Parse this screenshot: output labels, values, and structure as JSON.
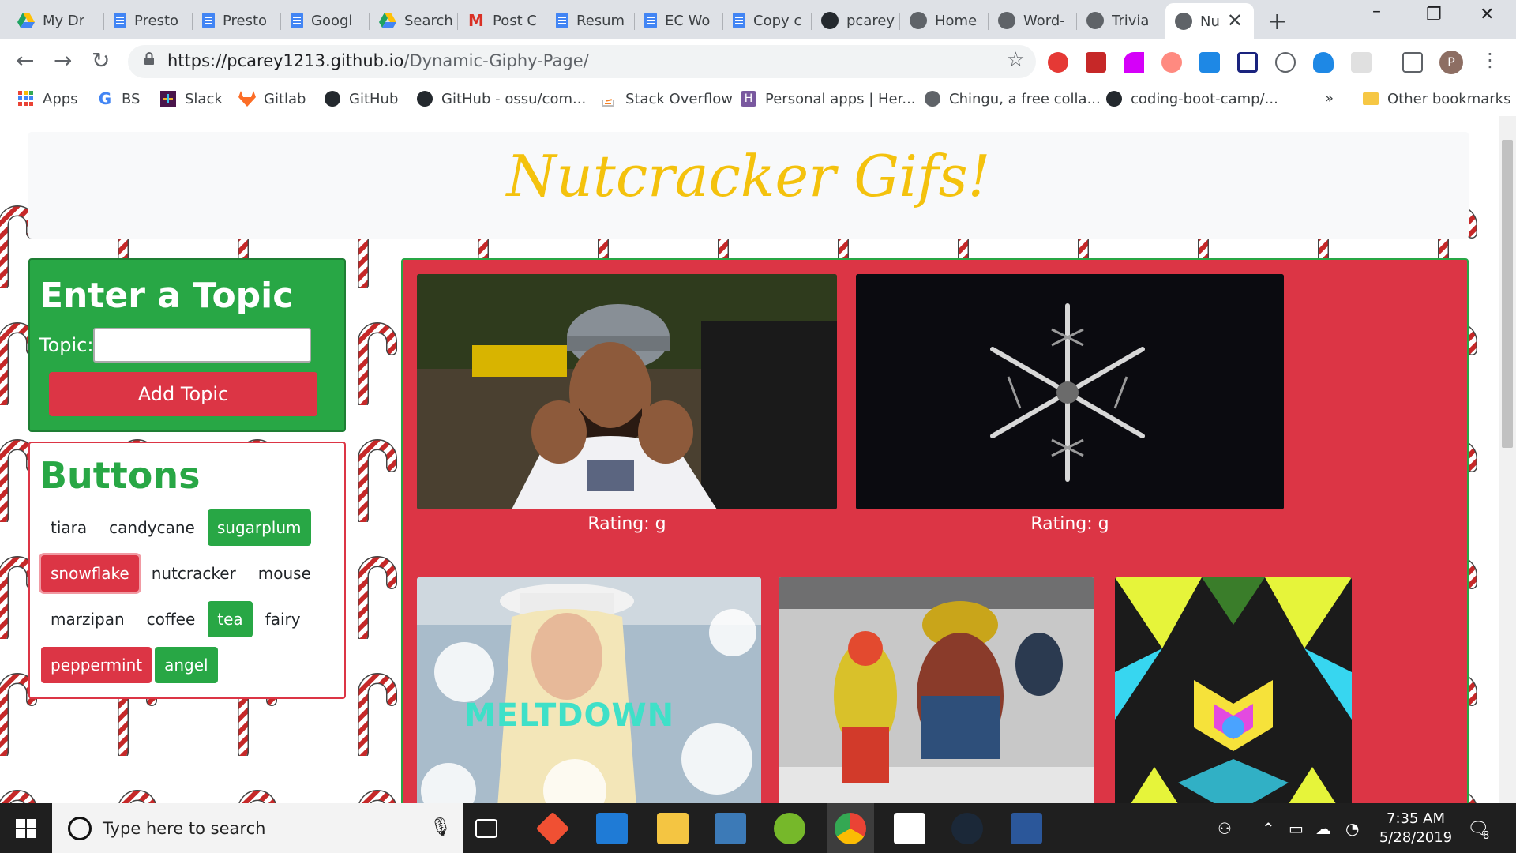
{
  "tabs": [
    {
      "title": "My Dr",
      "icon": "google-drive-icon"
    },
    {
      "title": "Presto",
      "icon": "google-docs-icon"
    },
    {
      "title": "Presto",
      "icon": "google-docs-icon"
    },
    {
      "title": "Googl",
      "icon": "google-docs-icon"
    },
    {
      "title": "Search",
      "icon": "google-drive-icon"
    },
    {
      "title": "Post C",
      "icon": "gmail-icon"
    },
    {
      "title": "Resum",
      "icon": "google-docs-icon"
    },
    {
      "title": "EC Wo",
      "icon": "google-docs-icon"
    },
    {
      "title": "Copy c",
      "icon": "google-docs-icon"
    },
    {
      "title": "pcarey",
      "icon": "github-icon"
    },
    {
      "title": "Home",
      "icon": "globe-icon"
    },
    {
      "title": "Word-",
      "icon": "globe-icon"
    },
    {
      "title": "Trivia",
      "icon": "globe-icon"
    },
    {
      "title": "Nu",
      "icon": "globe-icon"
    }
  ],
  "address_bar": {
    "url_host": "https://pcarey1213.github.io",
    "url_path": "/Dynamic-Giphy-Page/"
  },
  "bookmarks": [
    {
      "label": "Apps",
      "icon": "apps-grid-icon"
    },
    {
      "label": "BS",
      "icon": "google-icon"
    },
    {
      "label": "Slack",
      "icon": "slack-icon"
    },
    {
      "label": "Gitlab",
      "icon": "gitlab-icon"
    },
    {
      "label": "GitHub",
      "icon": "github-icon"
    },
    {
      "label": "GitHub - ossu/com...",
      "icon": "github-icon"
    },
    {
      "label": "Stack Overflow",
      "icon": "stack-overflow-icon"
    },
    {
      "label": "Personal apps | Her...",
      "icon": "heroku-icon"
    },
    {
      "label": "Chingu, a free colla...",
      "icon": "globe-icon"
    },
    {
      "label": "coding-boot-camp/...",
      "icon": "github-icon"
    }
  ],
  "bookmarks_more": "»",
  "other_bookmarks": "Other bookmarks",
  "profile_initial": "P",
  "page": {
    "title": "Nutcracker Gifs!",
    "topic_form": {
      "heading": "Enter a Topic",
      "label": "Topic:",
      "input_value": "",
      "submit_label": "Add Topic"
    },
    "buttons_panel": {
      "heading": "Buttons",
      "buttons": [
        {
          "label": "tiara",
          "style": "plain"
        },
        {
          "label": "candycane",
          "style": "plain"
        },
        {
          "label": "sugarplum",
          "style": "green"
        },
        {
          "label": "snowflake",
          "style": "focus"
        },
        {
          "label": "nutcracker",
          "style": "plain"
        },
        {
          "label": "mouse",
          "style": "plain"
        },
        {
          "label": "marzipan",
          "style": "plain"
        },
        {
          "label": "coffee",
          "style": "plain"
        },
        {
          "label": "tea",
          "style": "green"
        },
        {
          "label": "fairy",
          "style": "plain"
        },
        {
          "label": "peppermint",
          "style": "red"
        },
        {
          "label": "angel",
          "style": "green"
        }
      ]
    },
    "gifs": [
      {
        "subject": "man-in-yankees-jersey",
        "rating": "Rating: g"
      },
      {
        "subject": "snowflake-closeup",
        "rating": "Rating: g"
      },
      {
        "subject": "meltdown-snow",
        "caption": "MELTDOWN"
      },
      {
        "subject": "mcdonalds-mascots-snow"
      },
      {
        "subject": "kaleidoscope-snowflake"
      }
    ]
  },
  "taskbar": {
    "search_placeholder": "Type here to search",
    "time": "7:35 AM",
    "date": "5/28/2019",
    "notification_count": "8"
  },
  "colors": {
    "title_gold": "#f4c20d",
    "green": "#28a745",
    "red": "#dc3545"
  }
}
